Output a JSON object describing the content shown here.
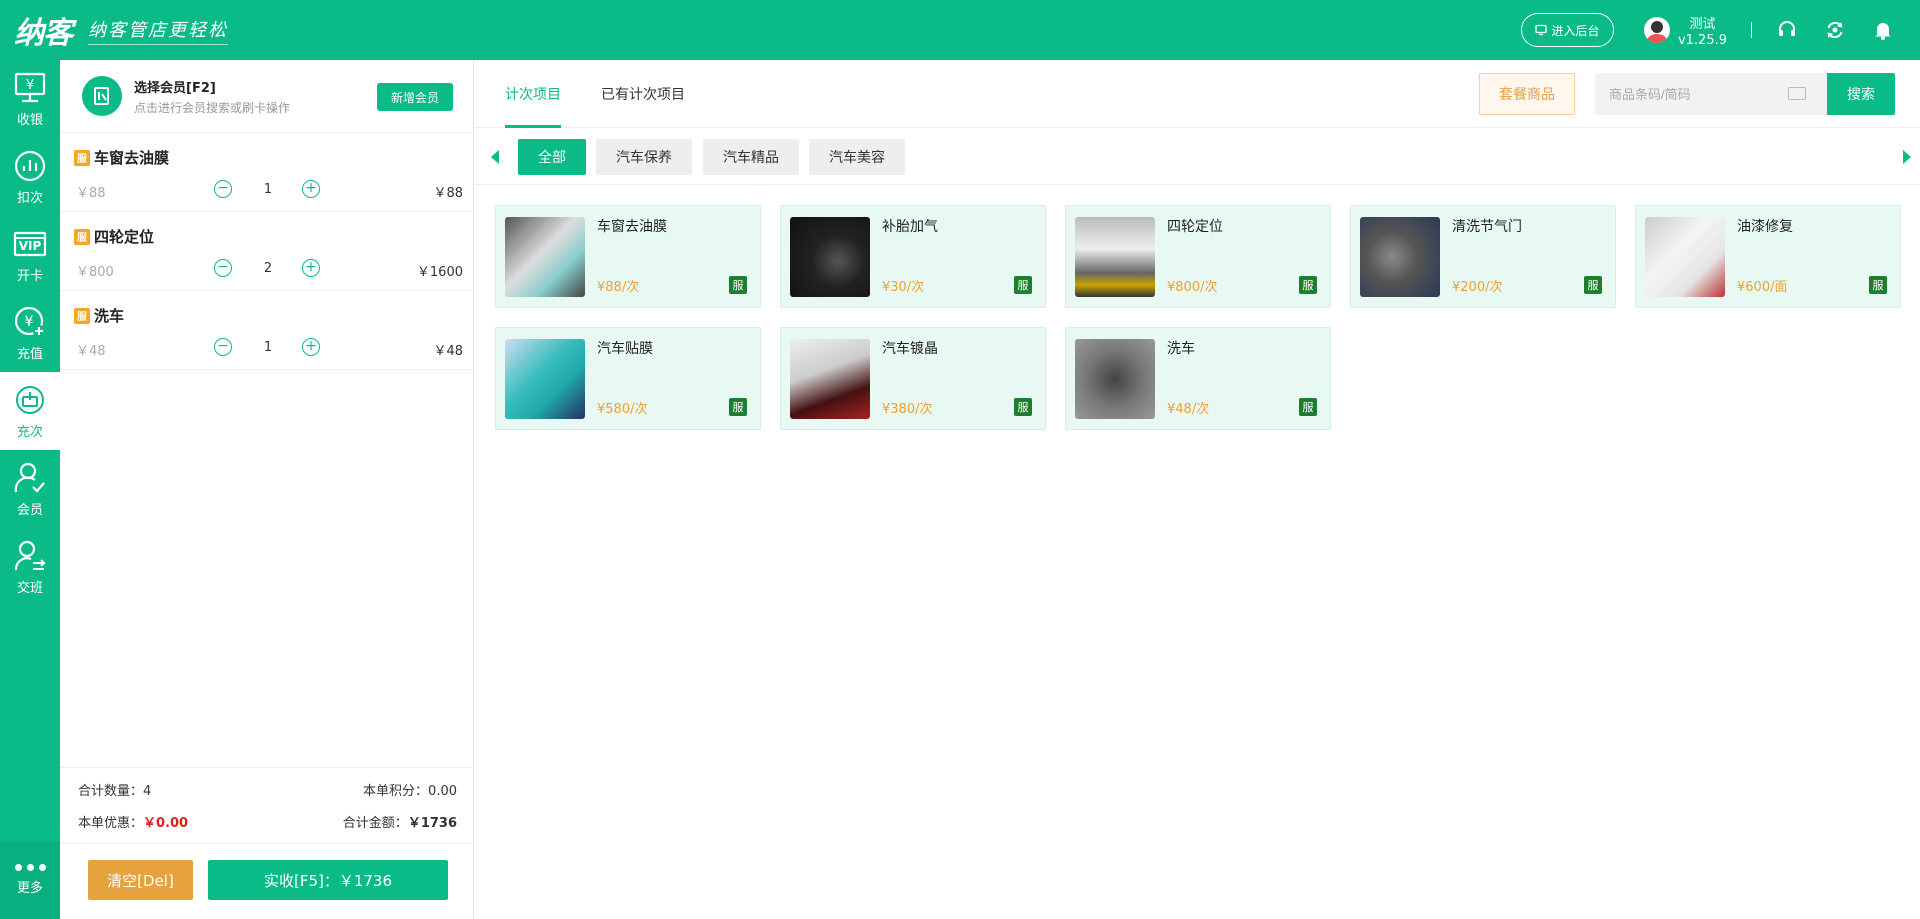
{
  "app": {
    "logo": "纳客",
    "slogan": "纳客管店更轻松",
    "admin_button": "进入后台",
    "user_name": "测试",
    "version": "v1.25.9",
    "accent_color": "#0abb87"
  },
  "leftnav": {
    "items": [
      {
        "label": "收银",
        "icon": "cashier-icon"
      },
      {
        "label": "扣次",
        "icon": "deduct-icon"
      },
      {
        "label": "开卡",
        "icon": "vip-card-icon"
      },
      {
        "label": "充值",
        "icon": "recharge-icon"
      },
      {
        "label": "充次",
        "icon": "recharge-times-icon",
        "active": true
      },
      {
        "label": "会员",
        "icon": "member-icon"
      },
      {
        "label": "交班",
        "icon": "shift-icon"
      }
    ],
    "more": "更多"
  },
  "member": {
    "title": "选择会员[F2]",
    "subtitle": "点击进行会员搜索或刷卡操作",
    "new_button": "新增会员"
  },
  "cart": {
    "badge": "服",
    "items": [
      {
        "name": "车窗去油膜",
        "unit_price": "￥88",
        "qty": "1",
        "total": "￥88"
      },
      {
        "name": "四轮定位",
        "unit_price": "￥800",
        "qty": "2",
        "total": "￥1600"
      },
      {
        "name": "洗车",
        "unit_price": "￥48",
        "qty": "1",
        "total": "￥48"
      }
    ],
    "summary": {
      "count_label": "合计数量：",
      "count": "4",
      "points_label": "本单积分：",
      "points": "0.00",
      "discount_label": "本单优惠：",
      "discount": "￥0.00",
      "amount_label": "合计金额：",
      "amount": "￥1736"
    },
    "clear_button": "清空[Del]",
    "pay_button": "实收[F5]：￥1736"
  },
  "main": {
    "tabs": [
      {
        "label": "计次项目",
        "active": true
      },
      {
        "label": "已有计次项目",
        "active": false
      }
    ],
    "package_button": "套餐商品",
    "search_placeholder": "商品条码/简码",
    "search_button": "搜索",
    "categories": [
      {
        "label": "全部",
        "active": true
      },
      {
        "label": "汽车保养",
        "active": false
      },
      {
        "label": "汽车精品",
        "active": false
      },
      {
        "label": "汽车美容",
        "active": false
      }
    ],
    "products": [
      {
        "name": "车窗去油膜",
        "price": "¥88/次",
        "badge": "服"
      },
      {
        "name": "补胎加气",
        "price": "¥30/次",
        "badge": "服"
      },
      {
        "name": "四轮定位",
        "price": "¥800/次",
        "badge": "服"
      },
      {
        "name": "清洗节气门",
        "price": "¥200/次",
        "badge": "服"
      },
      {
        "name": "油漆修复",
        "price": "¥600/面",
        "badge": "服"
      },
      {
        "name": "汽车贴膜",
        "price": "¥580/次",
        "badge": "服"
      },
      {
        "name": "汽车镀晶",
        "price": "¥380/次",
        "badge": "服"
      },
      {
        "name": "洗车",
        "price": "¥48/次",
        "badge": "服"
      }
    ]
  }
}
